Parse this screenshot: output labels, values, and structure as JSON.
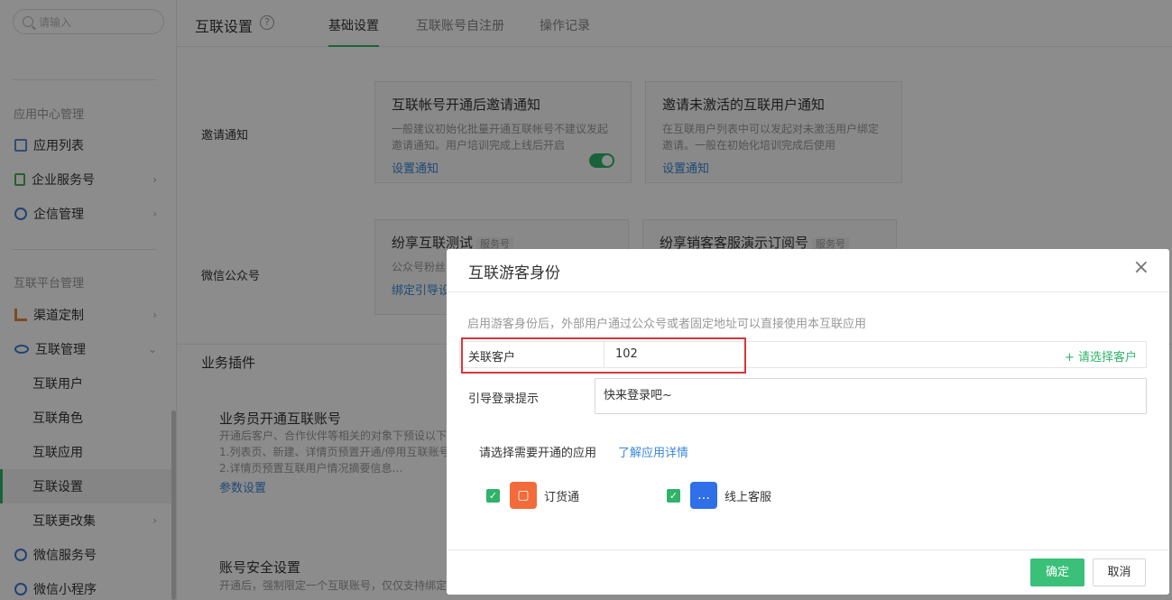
{
  "sidebar": {
    "search_placeholder": "请输入",
    "group_app_center": "应用中心管理",
    "items_app": [
      {
        "label": "应用列表",
        "icon": "grid-icon"
      },
      {
        "label": "企业服务号",
        "icon": "bookmark-icon"
      },
      {
        "label": "企信管理",
        "icon": "chat-icon"
      }
    ],
    "group_platform": "互联平台管理",
    "items_platform": [
      {
        "label": "渠道定制",
        "icon": "bar-chart-icon"
      },
      {
        "label": "互联管理",
        "icon": "link-icon"
      }
    ],
    "sub_items": [
      "互联用户",
      "互联角色",
      "互联应用",
      "互联设置",
      "互联更改集"
    ],
    "items_bottom": [
      {
        "label": "微信服务号",
        "icon": "wechat-icon"
      },
      {
        "label": "微信小程序",
        "icon": "mini-program-icon"
      }
    ]
  },
  "topbar": {
    "title": "互联设置",
    "help": "?",
    "tabs": [
      "基础设置",
      "互联账号自注册",
      "操作记录"
    ]
  },
  "main": {
    "invite_label": "邀请通知",
    "card1": {
      "title": "互联帐号开通后邀请通知",
      "desc1": "一般建议初始化批量开通互联帐号不建议发起",
      "desc2": "邀请通知。用户培训完成上线后开启",
      "link": "设置通知"
    },
    "card2": {
      "title": "邀请未激活的互联用户通知",
      "desc1": "在互联用户列表中可以发起对未激活用户绑定",
      "desc2": "邀请。一般在初始化培训完成后使用",
      "link": "设置通知"
    },
    "wechat_label": "微信公众号",
    "card3": {
      "title": "纷享互联测试",
      "tag": "服务号",
      "desc": "公众号粉丝",
      "link": "绑定引导设"
    },
    "card4": {
      "title": "纷享销客客服演示订阅号",
      "tag": "服务号"
    },
    "plugins_title": "业务插件",
    "plugin1": {
      "title": "业务员开通互联账号",
      "desc1": "开通后客户、合作伙伴等相关的对象下预设以下",
      "desc2": "1.列表页、新建、详情页预置开通/停用互联账号",
      "desc3": "2.详情页预置互联用户情况摘要信息…",
      "link": "参数设置"
    },
    "plugin2": {
      "title": "账号安全设置",
      "desc": "开通后，强制限定一个互联账号，仅仅支持绑定"
    }
  },
  "dialog": {
    "title": "互联游客身份",
    "close": "×",
    "note": "启用游客身份后，外部用户通过公众号或者固定地址可以直接使用本互联应用",
    "field1_label": "关联客户",
    "field1_value": "102",
    "field1_pick": "+ 请选择客户",
    "field2_label": "引导登录提示",
    "field2_value": "快来登录吧~",
    "apps_label": "请选择需要开通的应用",
    "apps_link": "了解应用详情",
    "apps": [
      {
        "name": "订货通",
        "color": "#f26b3a",
        "icon": "box-icon"
      },
      {
        "name": "线上客服",
        "color": "#2f6fe8",
        "icon": "chat-bubble-icon"
      }
    ],
    "ok": "确定",
    "cancel": "取消"
  }
}
